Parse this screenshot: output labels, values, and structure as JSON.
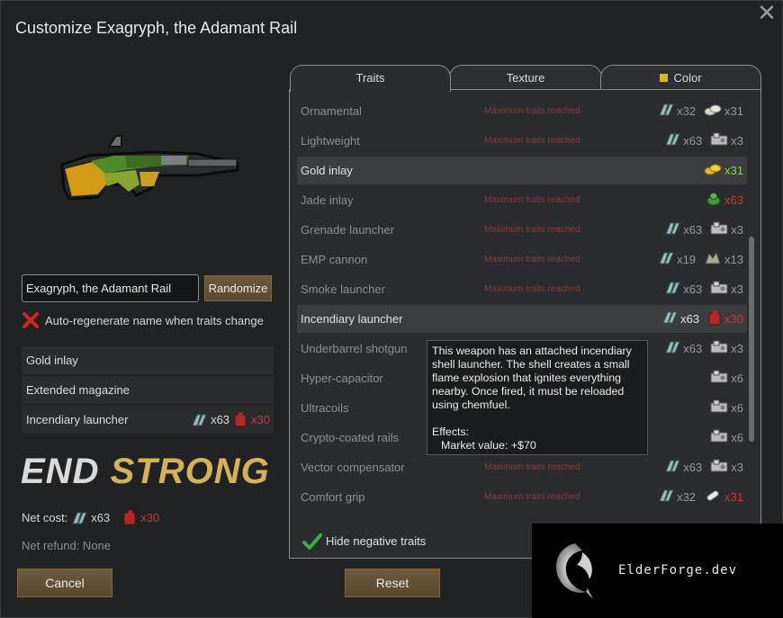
{
  "dialog": {
    "title": "Customize Exagryph, the Adamant Rail",
    "close_glyph": "✕"
  },
  "name_field": {
    "value": "Exagryph, the Adamant Rail"
  },
  "randomize_label": "Randomize",
  "auto_regen": {
    "label": "Auto-regenerate name when traits change",
    "checked": false
  },
  "selected_traits": [
    {
      "name": "Gold inlay",
      "costs": []
    },
    {
      "name": "Extended magazine",
      "costs": []
    },
    {
      "name": "Incendiary launcher",
      "costs": [
        {
          "icon": "plasteel-icon",
          "amount": "x63",
          "color": "normal"
        },
        {
          "icon": "chemfuel-icon",
          "amount": "x30",
          "color": "red"
        }
      ]
    }
  ],
  "quality_banner": {
    "word1": "END",
    "word2": "STRONG"
  },
  "net_cost": {
    "label": "Net cost:",
    "items": [
      {
        "icon": "plasteel-icon",
        "amount": "x63",
        "color": "normal"
      },
      {
        "icon": "chemfuel-icon",
        "amount": "x30",
        "color": "red"
      }
    ]
  },
  "net_refund": "Net refund: None",
  "buttons": {
    "cancel": "Cancel",
    "reset": "Reset"
  },
  "tabs": [
    {
      "label": "Traits",
      "active": true
    },
    {
      "label": "Texture",
      "active": false
    },
    {
      "label": "Color",
      "active": false,
      "swatch": "#e0b315"
    }
  ],
  "traits": [
    {
      "name": "Ornamental",
      "msg": "Maximum traits reached",
      "state": "disabled",
      "costs": [
        {
          "icon": "plasteel-icon",
          "amount": "x32",
          "color": "normal"
        },
        {
          "icon": "silver-icon",
          "amount": "x31",
          "color": "normal"
        }
      ]
    },
    {
      "name": "Lightweight",
      "msg": "Maximum traits reached",
      "state": "disabled",
      "costs": [
        {
          "icon": "plasteel-icon",
          "amount": "x63",
          "color": "normal"
        },
        {
          "icon": "components-icon",
          "amount": "x3",
          "color": "normal"
        }
      ]
    },
    {
      "name": "Gold inlay",
      "msg": "",
      "state": "selected",
      "costs": [
        {
          "icon": "gold-icon",
          "amount": "x31",
          "color": "green"
        }
      ]
    },
    {
      "name": "Jade inlay",
      "msg": "Maximum traits reached",
      "state": "disabled",
      "costs": [
        {
          "icon": "jade-icon",
          "amount": "x63",
          "color": "red"
        }
      ]
    },
    {
      "name": "Grenade launcher",
      "msg": "Maximum traits reached",
      "state": "disabled",
      "costs": [
        {
          "icon": "plasteel-icon",
          "amount": "x63",
          "color": "normal"
        },
        {
          "icon": "components-icon",
          "amount": "x3",
          "color": "normal"
        }
      ]
    },
    {
      "name": "EMP cannon",
      "msg": "Maximum traits reached",
      "state": "disabled",
      "costs": [
        {
          "icon": "plasteel-icon",
          "amount": "x19",
          "color": "normal"
        },
        {
          "icon": "uranium-icon",
          "amount": "x13",
          "color": "normal"
        }
      ]
    },
    {
      "name": "Smoke launcher",
      "msg": "Maximum traits reached",
      "state": "disabled",
      "costs": [
        {
          "icon": "plasteel-icon",
          "amount": "x63",
          "color": "normal"
        },
        {
          "icon": "components-icon",
          "amount": "x3",
          "color": "normal"
        }
      ]
    },
    {
      "name": "Incendiary launcher",
      "msg": "",
      "state": "selected",
      "costs": [
        {
          "icon": "plasteel-icon",
          "amount": "x63",
          "color": "normal"
        },
        {
          "icon": "chemfuel-icon",
          "amount": "x30",
          "color": "red"
        }
      ]
    },
    {
      "name": "Underbarrel shotgun",
      "msg": "",
      "state": "disabled",
      "costs": [
        {
          "icon": "plasteel-icon",
          "amount": "x63",
          "color": "normal"
        },
        {
          "icon": "components-icon",
          "amount": "x3",
          "color": "normal"
        }
      ]
    },
    {
      "name": "Hyper-capacitor",
      "msg": "",
      "state": "disabled",
      "costs": [
        {
          "icon": "components-icon",
          "amount": "x6",
          "color": "normal"
        }
      ]
    },
    {
      "name": "Ultracoils",
      "msg": "",
      "state": "disabled",
      "costs": [
        {
          "icon": "components-icon",
          "amount": "x6",
          "color": "normal"
        }
      ]
    },
    {
      "name": "Crypto-coated rails",
      "msg": "",
      "state": "disabled",
      "costs": [
        {
          "icon": "components-icon",
          "amount": "x6",
          "color": "normal"
        }
      ]
    },
    {
      "name": "Vector compensator",
      "msg": "Maximum traits reached",
      "state": "disabled",
      "costs": [
        {
          "icon": "plasteel-icon",
          "amount": "x63",
          "color": "normal"
        },
        {
          "icon": "components-icon",
          "amount": "x3",
          "color": "normal"
        }
      ]
    },
    {
      "name": "Comfort grip",
      "msg": "Maximum traits reached",
      "state": "disabled",
      "costs": [
        {
          "icon": "plasteel-icon",
          "amount": "x32",
          "color": "normal"
        },
        {
          "icon": "neutroamine-icon",
          "amount": "x31",
          "color": "red"
        }
      ]
    }
  ],
  "hide_negative": {
    "label": "Hide negative traits",
    "checked": true
  },
  "tooltip": {
    "lines": [
      "This weapon has an attached incendiary",
      "shell launcher. The shell creates a small",
      "flame explosion that ignites everything",
      "nearby. Once fired, it must be reloaded",
      "using chemfuel."
    ],
    "effects_label": "Effects:",
    "market_value": "Market value: +$70"
  },
  "watermark": "ElderForge.dev",
  "colors": {
    "accent_gold": "#d4b25a",
    "danger_red": "#c43a3a",
    "ok_green": "#8fd04a",
    "button_brown": "#6e5a3c"
  }
}
